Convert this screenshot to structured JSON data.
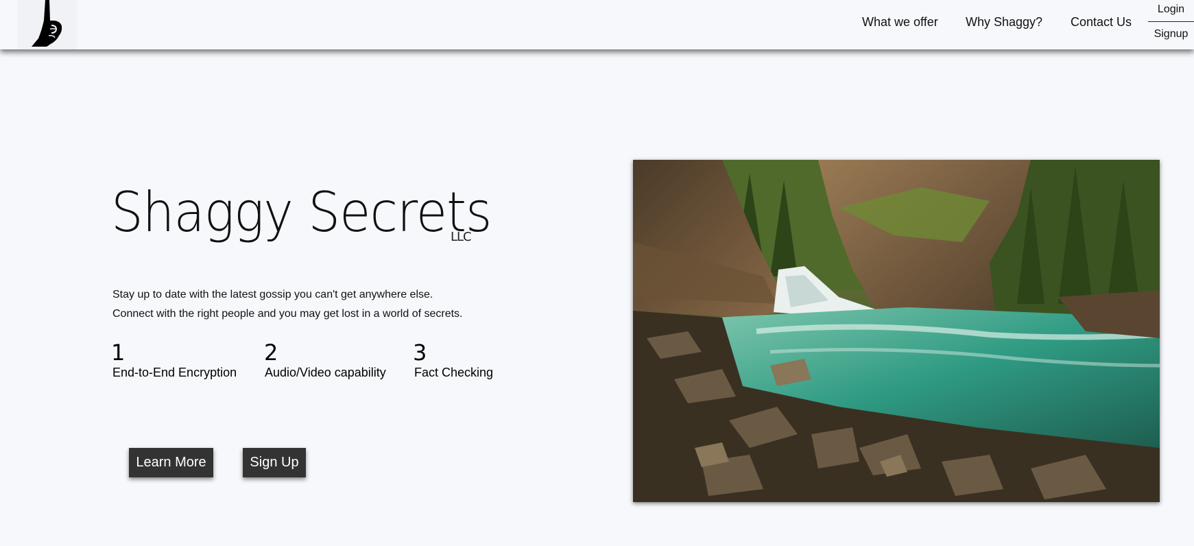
{
  "nav": {
    "logo": "logo-hush-hand-icon",
    "links": [
      "What we offer",
      "Why Shaggy?",
      "Contact Us"
    ],
    "auth": {
      "login": "Login",
      "signup": "Signup"
    }
  },
  "hero": {
    "title": "Shaggy Secrets",
    "title_suffix": "LLC",
    "tagline_lines": [
      "Stay up to date with the latest gossip you can't get anywhere else.",
      "Connect with the right people and you may get lost in a world of secrets."
    ],
    "features": [
      {
        "number": "1",
        "label": "End-to-End Encryption"
      },
      {
        "number": "2",
        "label": "Audio/Video capability"
      },
      {
        "number": "3",
        "label": "Fact Checking"
      }
    ],
    "buttons": {
      "learn_more": "Learn More",
      "sign_up": "Sign Up"
    },
    "image": "waterfall-canyon-photo"
  },
  "colors": {
    "background": "#f7f8fc",
    "button_bg": "#333333",
    "button_text": "#ffffff"
  }
}
